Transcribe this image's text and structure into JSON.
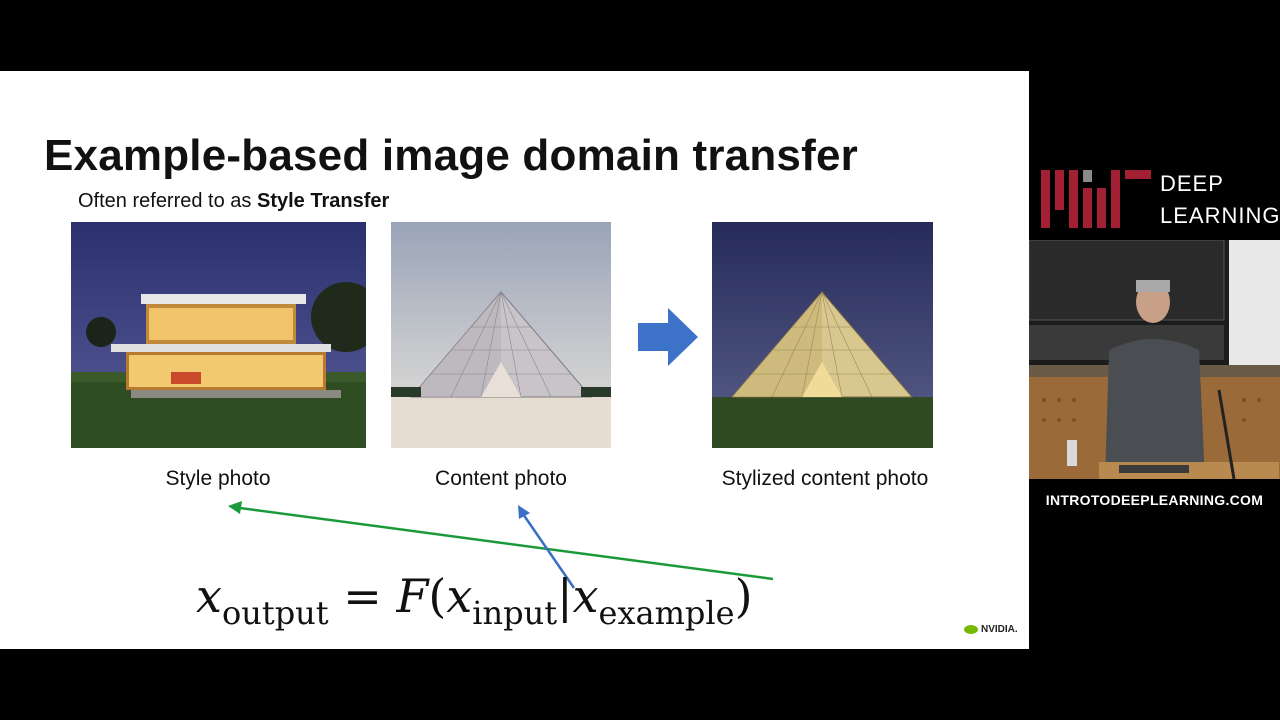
{
  "slide": {
    "title": "Example-based image domain transfer",
    "subtitle_prefix": "Often referred to as ",
    "subtitle_bold": "Style Transfer",
    "captions": {
      "style": "Style photo",
      "content": "Content photo",
      "stylized": "Stylized content photo"
    },
    "equation": {
      "lhs_var": "x",
      "lhs_sub": "output",
      "equals": "=",
      "func": "F",
      "open_paren": "(",
      "input_var": "x",
      "input_sub": "input",
      "bar": "|",
      "example_var": "x",
      "example_sub": "example",
      "close_paren": ")"
    },
    "nvidia_logo": "NVIDIA.",
    "arrow_colors": {
      "green": "#1a9a3a",
      "blue": "#3a6fc4",
      "right_arrow": "#3c73c8"
    }
  },
  "sidebar": {
    "logo_letters": "MIT",
    "logo_line1": "DEEP",
    "logo_line2": "LEARNING",
    "url": "INTROTODEEPLEARNING.COM",
    "brand_color": "#a31f34"
  }
}
